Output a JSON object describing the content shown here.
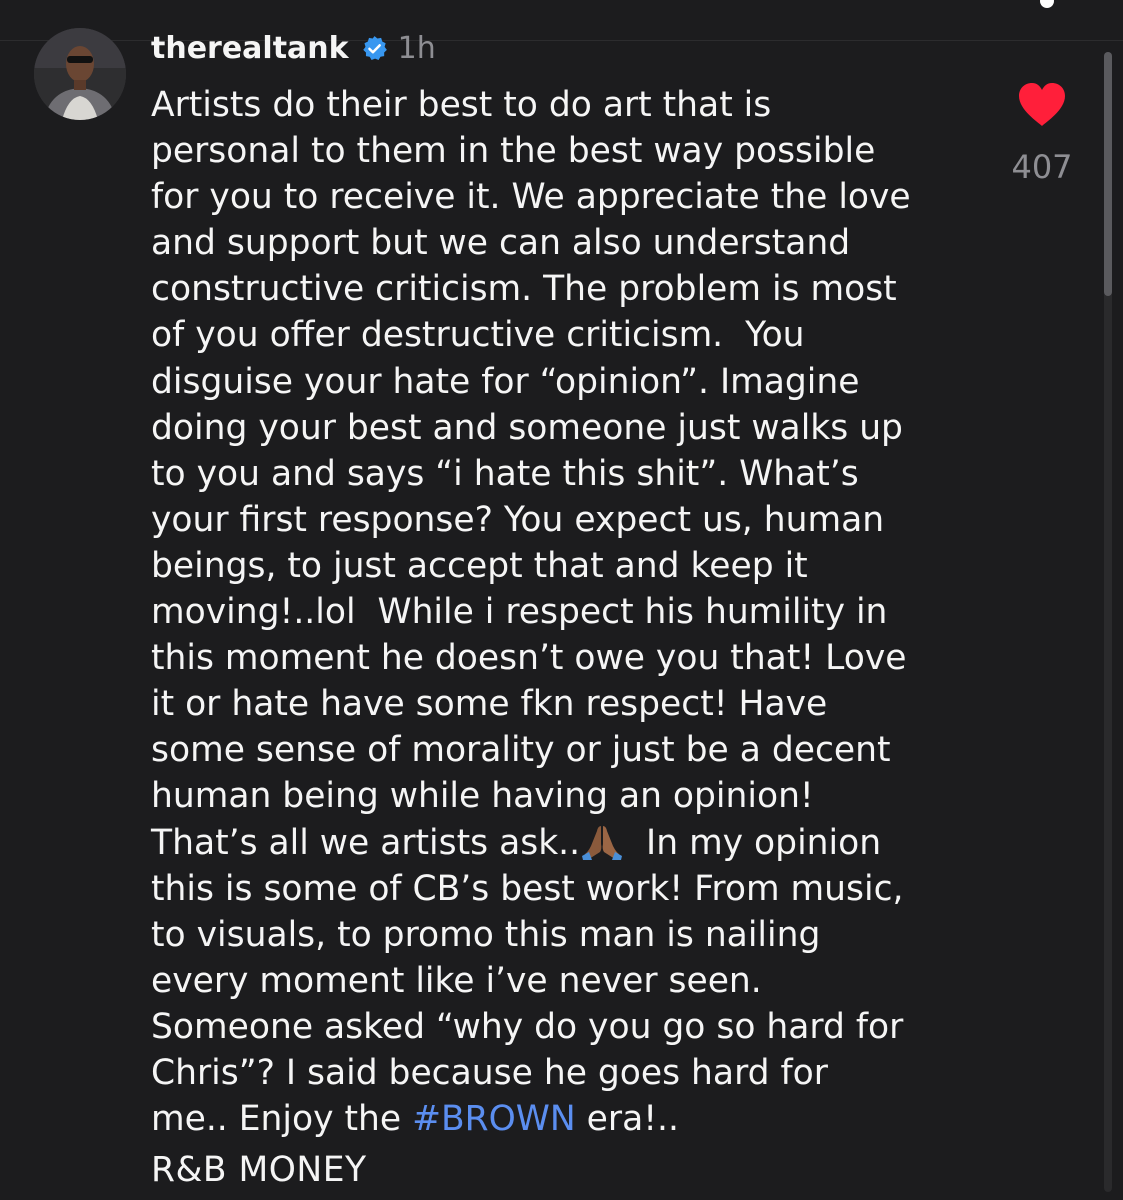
{
  "comment": {
    "username": "therealtank",
    "time": "1h",
    "lines": [
      "Artists do their best to do art that is",
      "personal to them in the best way possible",
      "for you to receive it. We appreciate the love",
      "and support but we can also understand",
      "constructive criticism. The problem is most",
      "of you offer destructive criticism.  You",
      "disguise your hate for “opinion”. Imagine",
      "doing your best and someone just walks up",
      "to you and says “i hate this shit”. What’s",
      "your first response? You expect us, human",
      "beings, to just accept that and keep it",
      "moving!..lol  While i respect his humility in",
      "this moment he doesn’t owe you that! Love",
      "it or hate have some fkn respect! Have",
      "some sense of morality or just be a decent",
      "human being while having an opinion!"
    ],
    "line17_before": "That’s all we artists ask..",
    "line17_after": "  In my opinion",
    "lines_after": [
      "this is some of CB’s best work! From music,",
      "to visuals, to promo this man is nailing",
      "every moment like i’ve never seen.",
      "Someone asked “why do you go so hard for",
      "Chris”? I said because he goes hard for"
    ],
    "last_line_before": "me.. Enjoy the ",
    "hashtag": "#BROWN",
    "last_line_after": " era!..",
    "footer": "R&B MONEY"
  },
  "likes": {
    "count": "407"
  },
  "colors": {
    "background": "#1c1c1e",
    "text": "#f5f5f5",
    "muted": "#8e8e93",
    "like_heart": "#ff1f3a",
    "verified": "#3897f0",
    "hashtag": "#5b8ef0"
  },
  "icons": {
    "like": "heart-icon",
    "verified": "verified-badge-icon",
    "emoji": "folded-hands-emoji"
  }
}
